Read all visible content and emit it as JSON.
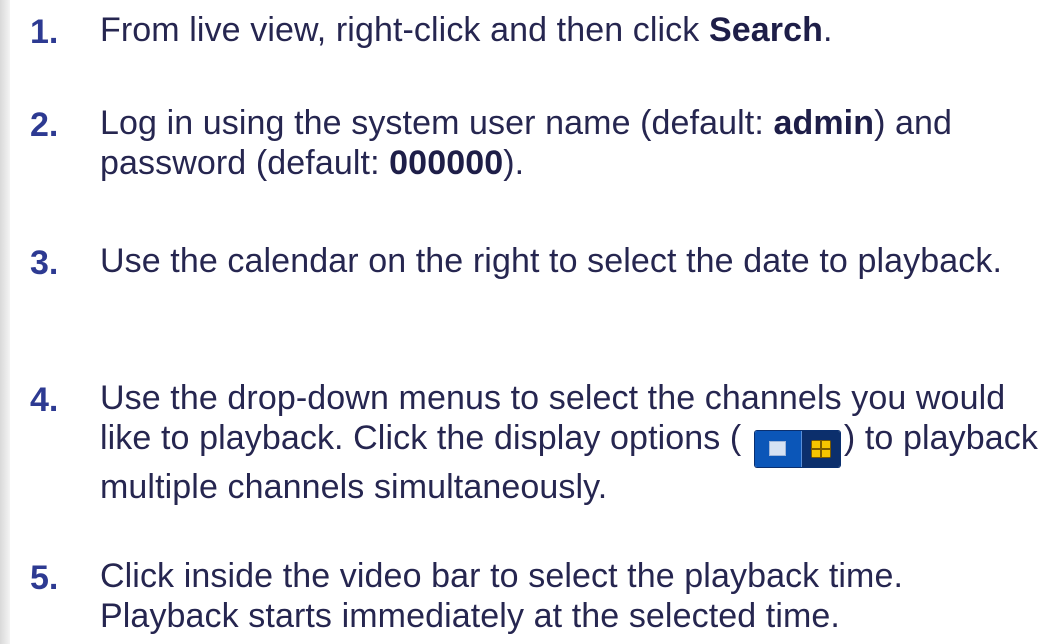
{
  "steps": [
    {
      "number": "1.",
      "parts": [
        "From live view, right-click and then click ",
        "Search",
        "."
      ]
    },
    {
      "number": "2.",
      "parts": [
        "Log in using the system user name (default: ",
        "admin",
        ") and password (default: ",
        "000000",
        ")."
      ]
    },
    {
      "number": "3.",
      "text": "Use the calendar on the right to select the date to playback."
    },
    {
      "number": "4.",
      "parts": [
        "Use the drop-down menus to select the channels you would like to playback. Click the display options ( ",
        ") to playback multiple channels simultaneously."
      ],
      "icons": [
        "single-view-icon",
        "quad-view-icon"
      ]
    },
    {
      "number": "5.",
      "text": "Click inside the video bar to select the playback time. Playback starts immediately at the selected time."
    }
  ],
  "colors": {
    "step_number": "#2d3a92",
    "body_text": "#262650",
    "icon_single_bg": "#0b56b8",
    "icon_quad_bg": "#0c2f6c",
    "icon_quad_fill": "#f5c400"
  }
}
